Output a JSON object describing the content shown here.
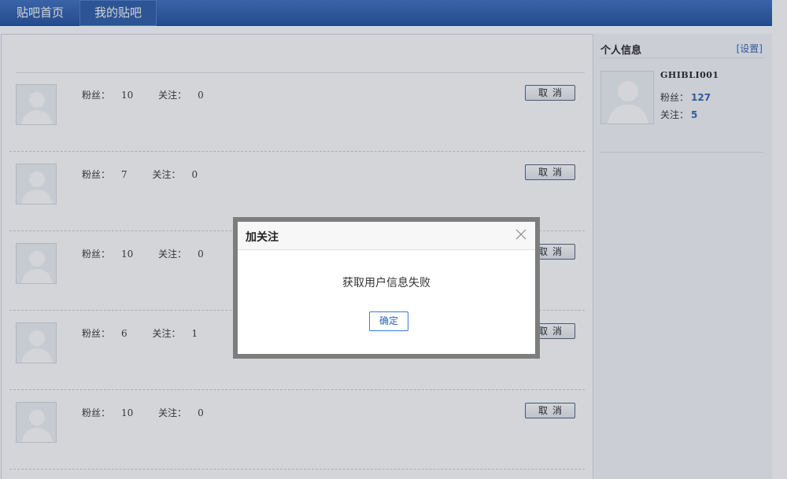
{
  "nav": {
    "tabs": [
      {
        "label": "贴吧首页"
      },
      {
        "label": "我的贴吧"
      }
    ]
  },
  "list": {
    "rows": [
      {
        "fans_label": "粉丝：",
        "fans": "10",
        "follow_label": "关注：",
        "follow": "0",
        "button": "取消"
      },
      {
        "fans_label": "粉丝：",
        "fans": "7",
        "follow_label": "关注：",
        "follow": "0",
        "button": "取消"
      },
      {
        "fans_label": "粉丝：",
        "fans": "10",
        "follow_label": "关注：",
        "follow": "0",
        "button": "取消"
      },
      {
        "fans_label": "粉丝：",
        "fans": "6",
        "follow_label": "关注：",
        "follow": "1",
        "button": "取消"
      },
      {
        "fans_label": "粉丝：",
        "fans": "10",
        "follow_label": "关注：",
        "follow": "0",
        "button": "取消"
      }
    ]
  },
  "sidebar": {
    "title": "个人信息",
    "settings": "[设置]",
    "username": "GHIBLI001",
    "fans_label": "粉丝：",
    "fans": "127",
    "follow_label": "关注：",
    "follow": "5"
  },
  "modal": {
    "title": "加关注",
    "message": "获取用户信息失败",
    "ok": "确定"
  },
  "colors": {
    "nav_bg": "#1d4f9f",
    "link": "#2d64b3",
    "overlay": "#3c4250"
  },
  "icons": {
    "avatar": "default-avatar-icon",
    "close": "close-icon"
  }
}
